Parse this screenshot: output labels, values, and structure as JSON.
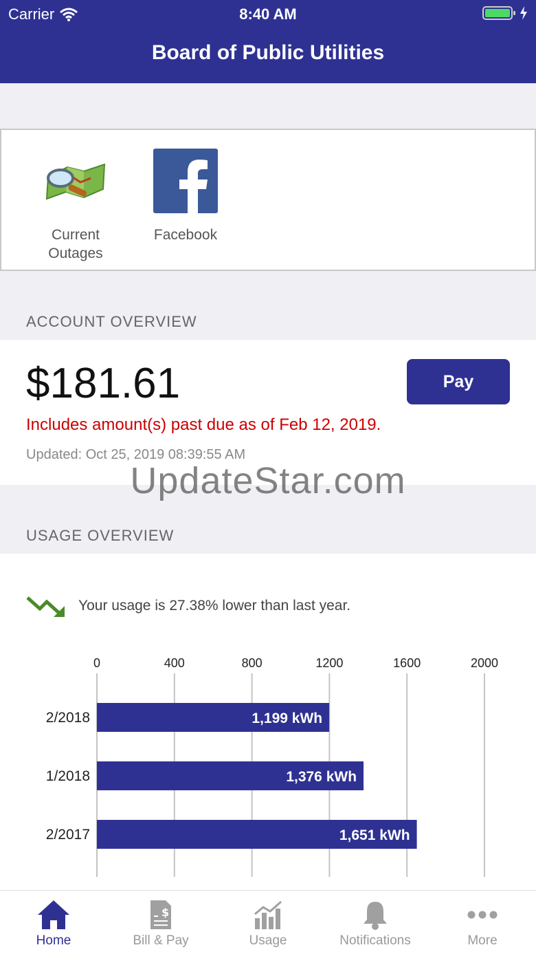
{
  "status_bar": {
    "carrier": "Carrier",
    "time": "8:40 AM"
  },
  "header": {
    "title": "Board of Public Utilities"
  },
  "shortcuts": [
    {
      "label_line1": "Current",
      "label_line2": "Outages",
      "icon": "outage-map-icon"
    },
    {
      "label": "Facebook",
      "icon": "facebook-icon"
    }
  ],
  "account": {
    "section_title": "ACCOUNT OVERVIEW",
    "amount": "$181.61",
    "pay_label": "Pay",
    "past_due_text": "Includes amount(s) past due as of Feb 12, 2019.",
    "updated_text": "Updated: Oct 25, 2019 08:39:55 AM"
  },
  "watermark": "UpdateStar.com",
  "usage": {
    "section_title": "USAGE OVERVIEW",
    "trend_text": "Your usage is 27.38% lower than last year.",
    "trend_icon": "trend-down-icon"
  },
  "chart_data": {
    "type": "bar",
    "orientation": "horizontal",
    "categories": [
      "2/2018",
      "1/2018",
      "2/2017"
    ],
    "values": [
      1199,
      1376,
      1651
    ],
    "value_labels": [
      "1,199 kWh",
      "1,376 kWh",
      "1,651 kWh"
    ],
    "xlim": [
      0,
      2000
    ],
    "ticks": [
      "0",
      "400",
      "800",
      "1200",
      "1600",
      "2000"
    ],
    "bar_color": "#2e3192",
    "grid": true
  },
  "tabs": [
    {
      "label": "Home",
      "icon": "home-icon",
      "active": true
    },
    {
      "label": "Bill & Pay",
      "icon": "bill-icon"
    },
    {
      "label": "Usage",
      "icon": "usage-chart-icon"
    },
    {
      "label": "Notifications",
      "icon": "bell-icon"
    },
    {
      "label": "More",
      "icon": "more-icon"
    }
  ],
  "colors": {
    "brand": "#2e3192",
    "alert": "#cc0000",
    "trend": "#4a8a2a"
  }
}
